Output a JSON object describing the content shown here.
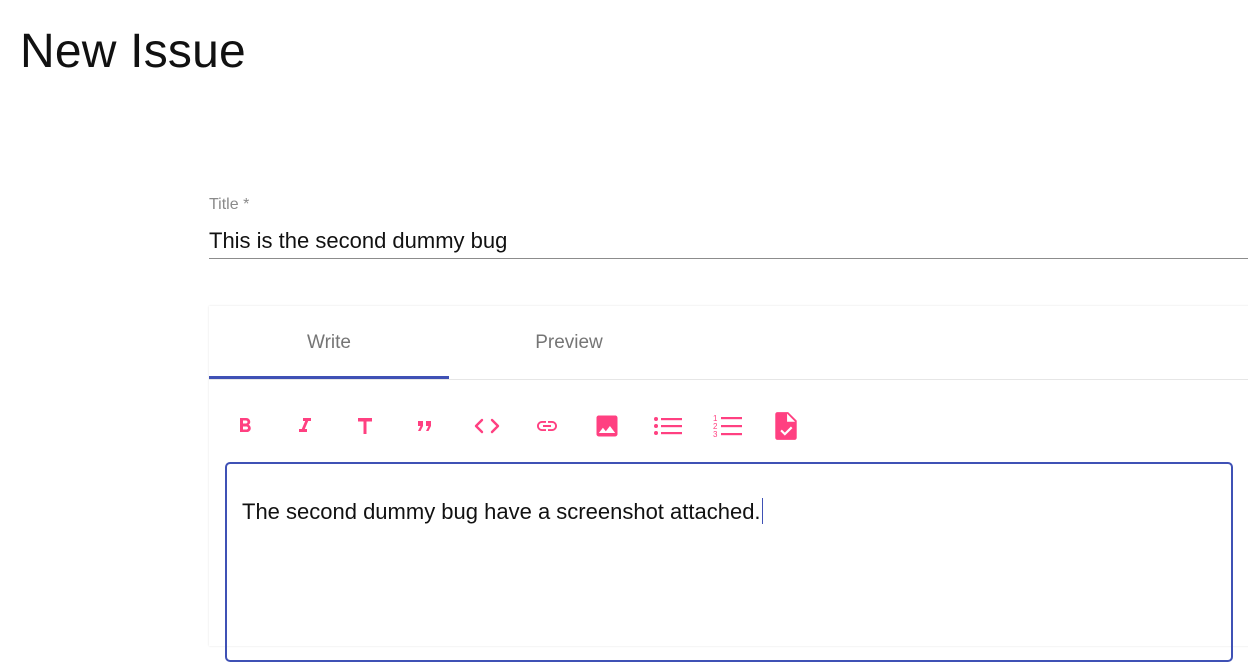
{
  "page": {
    "title": "New Issue"
  },
  "title_field": {
    "label": "Title *",
    "value": "This is the second dummy bug"
  },
  "editor": {
    "tabs": [
      {
        "label": "Write",
        "active": true
      },
      {
        "label": "Preview",
        "active": false
      }
    ],
    "toolbar": [
      {
        "name": "bold",
        "icon": "bold-icon"
      },
      {
        "name": "italic",
        "icon": "italic-icon"
      },
      {
        "name": "header",
        "icon": "header-icon"
      },
      {
        "name": "quote",
        "icon": "quote-icon"
      },
      {
        "name": "code",
        "icon": "code-icon"
      },
      {
        "name": "link",
        "icon": "link-icon"
      },
      {
        "name": "image",
        "icon": "image-icon"
      },
      {
        "name": "unordered-list",
        "icon": "unordered-list-icon"
      },
      {
        "name": "ordered-list",
        "icon": "ordered-list-icon"
      },
      {
        "name": "checked-list",
        "icon": "checked-list-icon"
      }
    ],
    "content": "The second dummy bug have a screenshot attached."
  },
  "colors": {
    "accent": "#ff4081",
    "primary": "#3f51b5"
  }
}
